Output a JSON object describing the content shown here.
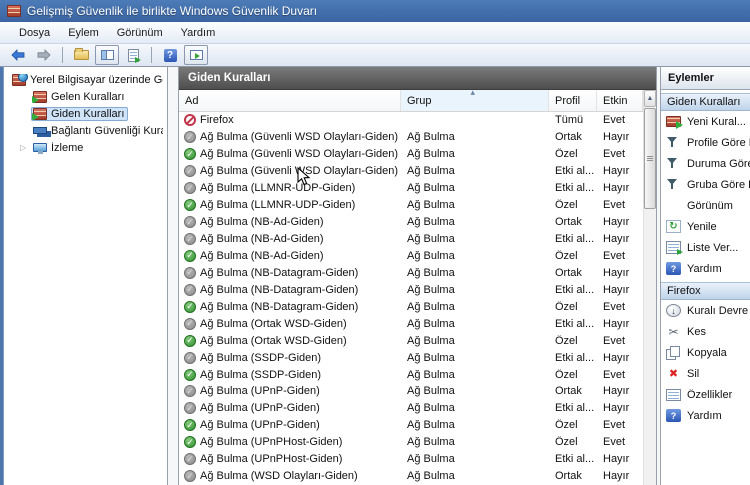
{
  "window": {
    "title": "Gelişmiş Güvenlik ile birlikte Windows Güvenlik Duvarı",
    "icon": "firewall-icon"
  },
  "menu": {
    "items": [
      "Dosya",
      "Eylem",
      "Görünüm",
      "Yardım"
    ]
  },
  "toolbar": {
    "buttons": [
      {
        "icon": "back-arrow"
      },
      {
        "icon": "forward-arrow"
      },
      {
        "icon": "up-folder"
      },
      {
        "icon": "console-tree-toggle"
      },
      {
        "icon": "export-list"
      },
      {
        "icon": "help"
      },
      {
        "icon": "action-pane-toggle"
      }
    ]
  },
  "tree": {
    "items": [
      {
        "key": "root",
        "label": "Yerel Bilgisayar üzerinde Gelişmiş Güvenlik ile birlikte Windows Güvenlik Duvarı",
        "icon": "firewall-root",
        "level": 0,
        "selected": false,
        "expander": false
      },
      {
        "key": "inbound-rules",
        "label": "Gelen Kuralları",
        "icon": "wall-arrow",
        "level": 1,
        "selected": false,
        "expander": false
      },
      {
        "key": "outbound-rules",
        "label": "Giden Kuralları",
        "icon": "wall-arrow",
        "level": 1,
        "selected": true,
        "expander": false
      },
      {
        "key": "connection-security-rules",
        "label": "Bağlantı Güvenliği Kuralları",
        "icon": "computers",
        "level": 1,
        "selected": false,
        "expander": false
      },
      {
        "key": "monitoring",
        "label": "İzleme",
        "icon": "monitor",
        "level": 1,
        "selected": false,
        "expander": true
      }
    ]
  },
  "main": {
    "header_title": "Giden Kuralları",
    "columns": [
      {
        "label": "Ad",
        "sorted": false
      },
      {
        "label": "Grup",
        "sorted": true
      },
      {
        "label": "Profil",
        "sorted": false
      },
      {
        "label": "Etkin",
        "sorted": false
      }
    ],
    "rows": [
      {
        "name": "Firefox",
        "group": "",
        "profile": "Tümü",
        "enabled": "Evet",
        "state": "blocked"
      },
      {
        "name": "Ağ Bulma (Güvenli WSD Olayları-Giden)",
        "group": "Ağ Bulma",
        "profile": "Ortak",
        "enabled": "Hayır",
        "state": "off"
      },
      {
        "name": "Ağ Bulma (Güvenli WSD Olayları-Giden)",
        "group": "Ağ Bulma",
        "profile": "Özel",
        "enabled": "Evet",
        "state": "on"
      },
      {
        "name": "Ağ Bulma (Güvenli WSD Olayları-Giden)",
        "group": "Ağ Bulma",
        "profile": "Etki al...",
        "enabled": "Hayır",
        "state": "off"
      },
      {
        "name": "Ağ Bulma (LLMNR-UDP-Giden)",
        "group": "Ağ Bulma",
        "profile": "Etki al...",
        "enabled": "Hayır",
        "state": "off"
      },
      {
        "name": "Ağ Bulma (LLMNR-UDP-Giden)",
        "group": "Ağ Bulma",
        "profile": "Özel",
        "enabled": "Evet",
        "state": "on"
      },
      {
        "name": "Ağ Bulma (NB-Ad-Giden)",
        "group": "Ağ Bulma",
        "profile": "Ortak",
        "enabled": "Hayır",
        "state": "off"
      },
      {
        "name": "Ağ Bulma (NB-Ad-Giden)",
        "group": "Ağ Bulma",
        "profile": "Etki al...",
        "enabled": "Hayır",
        "state": "off"
      },
      {
        "name": "Ağ Bulma (NB-Ad-Giden)",
        "group": "Ağ Bulma",
        "profile": "Özel",
        "enabled": "Evet",
        "state": "on"
      },
      {
        "name": "Ağ Bulma (NB-Datagram-Giden)",
        "group": "Ağ Bulma",
        "profile": "Ortak",
        "enabled": "Hayır",
        "state": "off"
      },
      {
        "name": "Ağ Bulma (NB-Datagram-Giden)",
        "group": "Ağ Bulma",
        "profile": "Etki al...",
        "enabled": "Hayır",
        "state": "off"
      },
      {
        "name": "Ağ Bulma (NB-Datagram-Giden)",
        "group": "Ağ Bulma",
        "profile": "Özel",
        "enabled": "Evet",
        "state": "on"
      },
      {
        "name": "Ağ Bulma (Ortak WSD-Giden)",
        "group": "Ağ Bulma",
        "profile": "Etki al...",
        "enabled": "Hayır",
        "state": "off"
      },
      {
        "name": "Ağ Bulma (Ortak WSD-Giden)",
        "group": "Ağ Bulma",
        "profile": "Özel",
        "enabled": "Evet",
        "state": "on"
      },
      {
        "name": "Ağ Bulma (SSDP-Giden)",
        "group": "Ağ Bulma",
        "profile": "Etki al...",
        "enabled": "Hayır",
        "state": "off"
      },
      {
        "name": "Ağ Bulma (SSDP-Giden)",
        "group": "Ağ Bulma",
        "profile": "Özel",
        "enabled": "Evet",
        "state": "on"
      },
      {
        "name": "Ağ Bulma (UPnP-Giden)",
        "group": "Ağ Bulma",
        "profile": "Ortak",
        "enabled": "Hayır",
        "state": "off"
      },
      {
        "name": "Ağ Bulma (UPnP-Giden)",
        "group": "Ağ Bulma",
        "profile": "Etki al...",
        "enabled": "Hayır",
        "state": "off"
      },
      {
        "name": "Ağ Bulma (UPnP-Giden)",
        "group": "Ağ Bulma",
        "profile": "Özel",
        "enabled": "Evet",
        "state": "on"
      },
      {
        "name": "Ağ Bulma (UPnPHost-Giden)",
        "group": "Ağ Bulma",
        "profile": "Özel",
        "enabled": "Evet",
        "state": "on"
      },
      {
        "name": "Ağ Bulma (UPnPHost-Giden)",
        "group": "Ağ Bulma",
        "profile": "Etki al...",
        "enabled": "Hayır",
        "state": "off"
      },
      {
        "name": "Ağ Bulma (WSD Olayları-Giden)",
        "group": "Ağ Bulma",
        "profile": "Ortak",
        "enabled": "Hayır",
        "state": "off"
      }
    ]
  },
  "actions": {
    "header": "Eylemler",
    "sections": [
      {
        "title": "Giden Kuralları",
        "items": [
          {
            "label": "Yeni Kural...",
            "icon": "new-rule"
          },
          {
            "label": "Profile Göre Filtre Uygula",
            "icon": "filter"
          },
          {
            "label": "Duruma Göre Filtre Uygula",
            "icon": "filter"
          },
          {
            "label": "Gruba Göre Filtre Uygula",
            "icon": "filter"
          },
          {
            "label": "Görünüm",
            "icon": "none"
          },
          {
            "label": "Yenile",
            "icon": "refresh"
          },
          {
            "label": "Liste Ver...",
            "icon": "export-list"
          },
          {
            "label": "Yardım",
            "icon": "help"
          }
        ]
      },
      {
        "title": "Firefox",
        "items": [
          {
            "label": "Kuralı Devre Dışı Bırak",
            "icon": "disable-rule"
          },
          {
            "label": "Kes",
            "icon": "cut"
          },
          {
            "label": "Kopyala",
            "icon": "copy"
          },
          {
            "label": "Sil",
            "icon": "delete"
          },
          {
            "label": "Özellikler",
            "icon": "properties"
          },
          {
            "label": "Yardım",
            "icon": "help"
          }
        ]
      }
    ]
  },
  "colors": {
    "titlebar_blue": "#3f6cae",
    "selection_blue": "#cfe4f9",
    "panel_header_gray": "#5a5a5a",
    "section_header_blue": "#bed3ea",
    "enabled_green": "#2e8f2e",
    "disabled_gray": "#8a8a8a",
    "blocked_red": "#c2354b"
  }
}
